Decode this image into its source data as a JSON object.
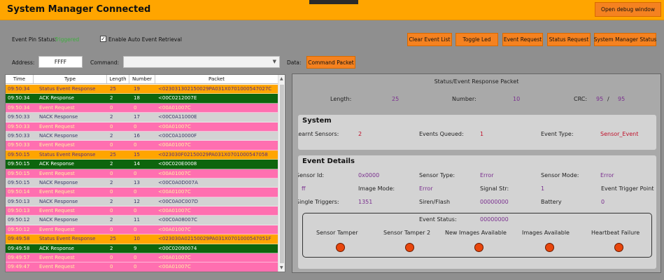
{
  "app": {
    "title": "System Manager Connected",
    "debug_button": "Open debug window"
  },
  "controls": {
    "event_pin_label": "Event Pin Status:",
    "event_pin_value": "Triggered",
    "auto_retrieval_label": "Enable Auto Event Retrieval",
    "auto_retrieval_checked": true,
    "address_label": "Address:",
    "address_value": "FFFF",
    "command_label": "Command:",
    "command_value": "",
    "data_label": "Data:",
    "command_packet_button": "Command Packet",
    "buttons": {
      "clear": "Clear Event List",
      "toggle": "Toggle Led",
      "event_request": "Event Request",
      "status_request": "Status Request",
      "sysmgr_status": "System Manager Status"
    }
  },
  "table": {
    "columns": [
      "Time",
      "Type",
      "Length",
      "Number",
      "Packet"
    ],
    "rows": [
      {
        "time": "09:50:34",
        "type": "Status Event Response",
        "len": "25",
        "num": "19",
        "pkt": "<023031302150029PA031X0701000547027C",
        "kind": "status"
      },
      {
        "time": "09:50:34",
        "type": "ACK Response",
        "len": "2",
        "num": "18",
        "pkt": "<00C0212007E",
        "kind": "ack"
      },
      {
        "time": "09:50:34",
        "type": "Event Request",
        "len": "0",
        "num": "0",
        "pkt": "<00A01007C",
        "kind": "event"
      },
      {
        "time": "09:50:33",
        "type": "NACK Response",
        "len": "2",
        "num": "17",
        "pkt": "<00C0A11000E",
        "kind": "nack"
      },
      {
        "time": "09:50:33",
        "type": "Event Request",
        "len": "0",
        "num": "0",
        "pkt": "<00A01007C",
        "kind": "event"
      },
      {
        "time": "09:50:33",
        "type": "NACK Response",
        "len": "2",
        "num": "16",
        "pkt": "<00C0A10000F",
        "kind": "nack"
      },
      {
        "time": "09:50:33",
        "type": "Event Request",
        "len": "0",
        "num": "0",
        "pkt": "<00A01007C",
        "kind": "event"
      },
      {
        "time": "09:50:15",
        "type": "Status Event Response",
        "len": "25",
        "num": "15",
        "pkt": "<023030F02150029PA031X0701000547058",
        "kind": "status"
      },
      {
        "time": "09:50:15",
        "type": "ACK Response",
        "len": "2",
        "num": "14",
        "pkt": "<00C020E0008",
        "kind": "ack"
      },
      {
        "time": "09:50:15",
        "type": "Event Request",
        "len": "0",
        "num": "0",
        "pkt": "<00A01007C",
        "kind": "event"
      },
      {
        "time": "09:50:15",
        "type": "NACK Response",
        "len": "2",
        "num": "13",
        "pkt": "<00C0A0D007A",
        "kind": "nack"
      },
      {
        "time": "09:50:14",
        "type": "Event Request",
        "len": "0",
        "num": "0",
        "pkt": "<00A01007C",
        "kind": "event"
      },
      {
        "time": "09:50:13",
        "type": "NACK Response",
        "len": "2",
        "num": "12",
        "pkt": "<00C0A0C007D",
        "kind": "nack"
      },
      {
        "time": "09:50:13",
        "type": "Event Request",
        "len": "0",
        "num": "0",
        "pkt": "<00A01007C",
        "kind": "event"
      },
      {
        "time": "09:50:12",
        "type": "NACK Response",
        "len": "2",
        "num": "11",
        "pkt": "<00C0A08007C",
        "kind": "nack"
      },
      {
        "time": "09:50:12",
        "type": "Event Request",
        "len": "0",
        "num": "0",
        "pkt": "<00A01007C",
        "kind": "event"
      },
      {
        "time": "09:49:58",
        "type": "Status Event Response",
        "len": "25",
        "num": "10",
        "pkt": "<023030A02150029PA031X0701000547051F",
        "kind": "status"
      },
      {
        "time": "09:49:58",
        "type": "ACK Response",
        "len": "2",
        "num": "9",
        "pkt": "<00C02090074",
        "kind": "ack"
      },
      {
        "time": "09:49:57",
        "type": "Event Request",
        "len": "0",
        "num": "0",
        "pkt": "<00A01007C",
        "kind": "event"
      },
      {
        "time": "09:49:47",
        "type": "Event Request",
        "len": "0",
        "num": "0",
        "pkt": "<00A01007C",
        "kind": "event"
      }
    ]
  },
  "panel": {
    "title": "Status/Event Response Packet",
    "length_label": "Length:",
    "length_value": "25",
    "number_label": "Number:",
    "number_value": "10",
    "crc_label": "CRC:",
    "crc_a": "95",
    "crc_sep": "/",
    "crc_b": "95",
    "system": {
      "title": "System",
      "learnt_label": "Learnt Sensors:",
      "learnt_value": "2",
      "queued_label": "Events Queued:",
      "queued_value": "1",
      "type_label": "Event Type:",
      "type_value": "Sensor_Event"
    },
    "event": {
      "title": "Event Details",
      "sensor_id_label": "Sensor Id:",
      "sensor_id_value": "0x0000",
      "sensor_type_label": "Sensor Type:",
      "sensor_type_value": "Error",
      "sensor_mode_label": "Sensor Mode:",
      "sensor_mode_value": "Error",
      "left_value": "ff",
      "image_mode_label": "Image Mode:",
      "image_mode_value": "Error",
      "signal_label": "Signal Str:",
      "signal_value": "1",
      "trigger_point_label": "Event Trigger Point",
      "single_label": "Single Triggers:",
      "single_value": "1351",
      "siren_label": "Siren/Flash",
      "siren_value": "00000000",
      "battery_label": "Battery",
      "battery_value": "0",
      "status_label": "Event Status:",
      "status_value": "00000000",
      "indicators": [
        "Sensor Tamper",
        "Sensor Tamper 2",
        "New Images Available",
        "Images Available",
        "Heartbeat Failure"
      ]
    }
  }
}
